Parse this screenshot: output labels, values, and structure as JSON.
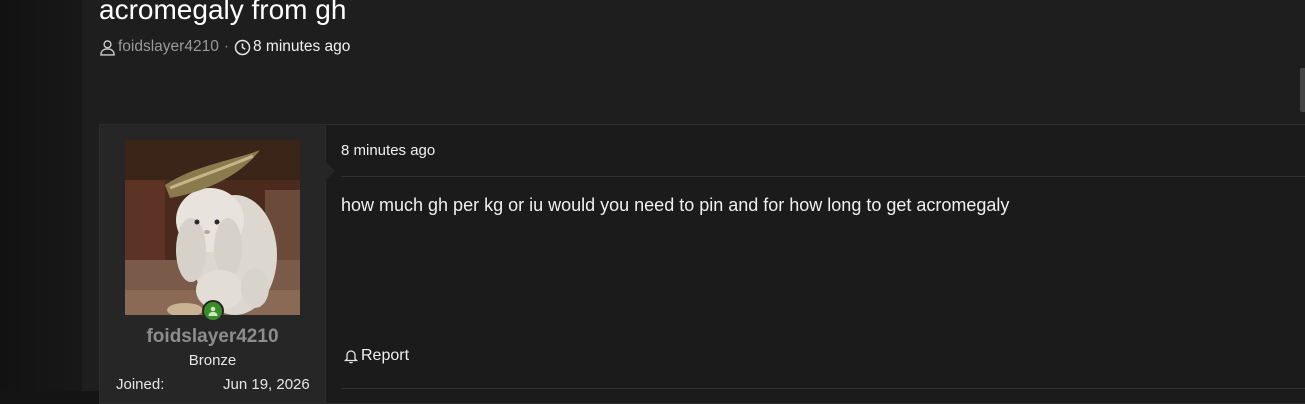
{
  "thread": {
    "title": "acromegaly from gh",
    "author": "foidslayer4210",
    "separator": "·",
    "time_ago": "8 minutes ago"
  },
  "post": {
    "date": "8 minutes ago",
    "body": "how much gh per kg or iu would you need to pin and for how long to get acromegaly",
    "report_label": "Report"
  },
  "user": {
    "username": "foidslayer4210",
    "rank": "Bronze",
    "joined_label": "Joined:",
    "joined_value": "Jun 19, 2026",
    "online": true
  },
  "colors": {
    "background": "#141414",
    "panel": "#1e1e1e",
    "user_panel": "#262626",
    "online": "#3a8c2b",
    "username": "#8d8d8d"
  }
}
